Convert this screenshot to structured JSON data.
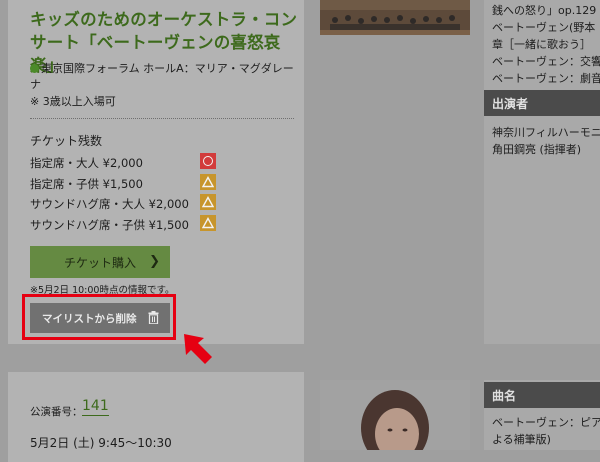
{
  "event1": {
    "title_cut": "　　　　　",
    "title": "キッズのためのオーケストラ・コンサート「ベートーヴェンの喜怒哀楽」",
    "venue": "東京国際フォーラム ホールA：マリア・マグダレーナ",
    "age_note": "※ 3歳以上入場可",
    "remaining_title": "チケット残数",
    "tickets": [
      {
        "label": "指定席・大人 ¥2,000",
        "status": "circle",
        "status_color": "#d23b3b"
      },
      {
        "label": "指定席・子供 ¥1,500",
        "status": "triangle",
        "status_color": "#c7952c"
      },
      {
        "label": "サウンドハグ席・大人 ¥2,000",
        "status": "triangle",
        "status_color": "#c7952c"
      },
      {
        "label": "サウンドハグ席・子供 ¥1,500",
        "status": "triangle",
        "status_color": "#c7952c"
      }
    ],
    "buy_label": "チケット購入",
    "buy_icon": "chevron-right-icon",
    "info_note": "※5月2日 10:00時点の情報です。",
    "remove_label": "マイリストから削除",
    "remove_icon": "trash-icon",
    "highlight_color": "#e60012"
  },
  "right_panel": {
    "program_lines": [
      "銭への怒り」op.129",
      "ベートーヴェン(野本",
      "章［一緒に歌おう］",
      "ベートーヴェン：交響",
      "ベートーヴェン：劇音"
    ],
    "performers_header": "出演者",
    "performers": [
      "神奈川フィルハーモニ",
      "角田鋼亮 (指揮者)"
    ]
  },
  "event2": {
    "perf_label": "公演番号：",
    "perf_number": "141",
    "date": "5月2日 (土) 9:45〜10:30",
    "pieces_header": "曲名",
    "pieces": [
      "ベートーヴェン：ピア",
      "よる補筆版)"
    ]
  }
}
